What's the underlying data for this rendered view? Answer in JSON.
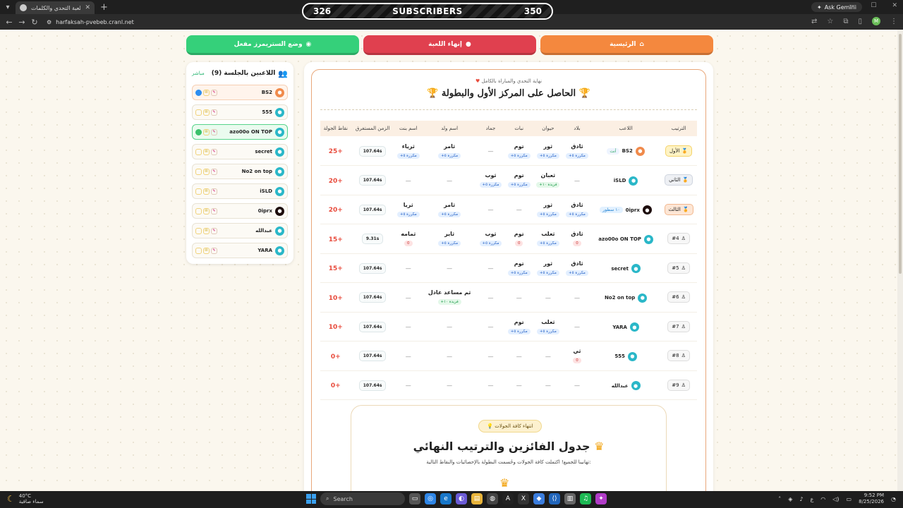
{
  "browser": {
    "tab_title": "حرفك صح | لعبة التحدي والكلمات",
    "url": "harfaksah-pvebeb.cranl.net",
    "ask_gemini": "Ask Gemini",
    "profile_initial": "M"
  },
  "subscribers": {
    "left": "326",
    "label": "SUBSCRIBERS",
    "right": "350"
  },
  "top_buttons": {
    "home": "الرئيسية",
    "stop": "إنهاء اللعبة",
    "spectator": "وضع الستريمرز مفعل"
  },
  "sidebar": {
    "title": "اللاعبين بالجلسة (9)",
    "live": "مباشر",
    "players": [
      {
        "name": "BS2"
      },
      {
        "name": "555"
      },
      {
        "name": "azo00o ON TOP"
      },
      {
        "name": "secret"
      },
      {
        "name": "No2 on top"
      },
      {
        "name": "iSLD"
      },
      {
        "name": "0iprx"
      },
      {
        "name": "عبدالله"
      },
      {
        "name": "YARA"
      }
    ]
  },
  "results": {
    "subtitle": "نهاية التحدي والمباراة بالكامل",
    "title": "الحاصل على المركز الأول والبطولة",
    "headers": [
      "الترتيب",
      "اللاعب",
      "بلاد",
      "حيوان",
      "نبات",
      "جماد",
      "اسم ولد",
      "اسم بنت",
      "الزمن المستغرق",
      "نقاط الجولة"
    ],
    "you_tag": "أنت",
    "rows": [
      {
        "rank": "الأول",
        "player": "BS2",
        "tag": "أنت",
        "cells": [
          {
            "w": "ثادق",
            "c": "مكررة ٥+"
          },
          {
            "w": "ثور",
            "c": "مكررة ٥+"
          },
          {
            "w": "توم",
            "c": "مكررة ٥+"
          },
          {
            "w": "—"
          },
          {
            "w": "ثامر",
            "c": "مكررة ٥+"
          },
          {
            "w": "ثرياء",
            "c": "مكررة ٥+"
          }
        ],
        "time": "107.64s",
        "points": "+25"
      },
      {
        "rank": "الثاني",
        "player": "iSLD",
        "tag": "",
        "cells": [
          {
            "w": "—"
          },
          {
            "w": "ثعبان",
            "c": "فريدة ١٠+",
            "u": true
          },
          {
            "w": "توم",
            "c": "مكررة ٥+"
          },
          {
            "w": "ثوب",
            "c": "مكررة ٥+"
          },
          {
            "w": "—"
          },
          {
            "w": "—"
          }
        ],
        "time": "107.64s",
        "points": "+20"
      },
      {
        "rank": "الثالث",
        "player": "0iprx",
        "tag": "١٠ سطور",
        "cells": [
          {
            "w": "ثادق",
            "c": "مكررة ٥+"
          },
          {
            "w": "ثور",
            "c": "مكررة ٥+"
          },
          {
            "w": "—"
          },
          {
            "w": "—"
          },
          {
            "w": "ثامر",
            "c": "مكررة ٥+"
          },
          {
            "w": "ثريا",
            "c": "مكررة ٥+"
          }
        ],
        "time": "107.64s",
        "points": "+20"
      },
      {
        "rank": "#4",
        "player": "azo00o ON TOP",
        "tag": "",
        "cells": [
          {
            "w": "ثادق",
            "c": "0",
            "z": true
          },
          {
            "w": "ثعلب",
            "c": "مكررة ٥+"
          },
          {
            "w": "توم",
            "c": "0",
            "z": true
          },
          {
            "w": "ثوب",
            "c": "مكررة ٥+"
          },
          {
            "w": "ثاير",
            "c": "مكررة ٥+"
          },
          {
            "w": "ثمامه",
            "c": "0",
            "z": true
          }
        ],
        "time": "9.31s",
        "points": "+15"
      },
      {
        "rank": "#5",
        "player": "secret",
        "tag": "",
        "cells": [
          {
            "w": "ثادق",
            "c": "مكررة ٥+"
          },
          {
            "w": "ثور",
            "c": "مكررة ٥+"
          },
          {
            "w": "توم",
            "c": "مكررة ٥+"
          },
          {
            "w": "—"
          },
          {
            "w": "—"
          },
          {
            "w": "—"
          }
        ],
        "time": "107.64s",
        "points": "+15"
      },
      {
        "rank": "#6",
        "player": "No2 on top",
        "tag": "",
        "cells": [
          {
            "w": "—"
          },
          {
            "w": "—"
          },
          {
            "w": "—"
          },
          {
            "w": "—"
          },
          {
            "w": "ثم مساعد عادل",
            "c": "فريدة ١٠+",
            "u": true
          },
          {
            "w": "—"
          }
        ],
        "time": "107.64s",
        "points": "+10"
      },
      {
        "rank": "#7",
        "player": "YARA",
        "tag": "",
        "cells": [
          {
            "w": "—"
          },
          {
            "w": "ثعلب",
            "c": "مكررة ٥+"
          },
          {
            "w": "توم",
            "c": "مكررة ٥+"
          },
          {
            "w": "—"
          },
          {
            "w": "—"
          },
          {
            "w": "—"
          }
        ],
        "time": "107.64s",
        "points": "+10"
      },
      {
        "rank": "#8",
        "player": "555",
        "tag": "",
        "cells": [
          {
            "w": "ثي",
            "c": "0",
            "z": true
          },
          {
            "w": "—"
          },
          {
            "w": "—"
          },
          {
            "w": "—"
          },
          {
            "w": "—"
          },
          {
            "w": "—"
          }
        ],
        "time": "107.64s",
        "points": "+0"
      },
      {
        "rank": "#9",
        "player": "عبدالله",
        "tag": "",
        "cells": [
          {
            "w": "—"
          },
          {
            "w": "—"
          },
          {
            "w": "—"
          },
          {
            "w": "—"
          },
          {
            "w": "—"
          },
          {
            "w": "—"
          }
        ],
        "time": "107.64s",
        "points": "+0"
      }
    ]
  },
  "winners": {
    "badge": "انتهاء كافة الجولات",
    "title": "جدول الفائزين والترتيب النهائي",
    "desc": "تهانينا للجميع! اكتملت كافة الجولات وحُسمت البطولة بالإحصائيات والنقاط التالية:"
  },
  "taskbar": {
    "temp": "40°C",
    "weather": "سماء صافية",
    "search": "Search",
    "time": "9:52 PM",
    "date": "8/25/2026",
    "lang": "ع"
  },
  "colors": {
    "home": "#f4883e",
    "stop": "#e0404f",
    "spectator": "#35d07a",
    "accent": "#e9a77a",
    "points": "#e84b3c"
  }
}
